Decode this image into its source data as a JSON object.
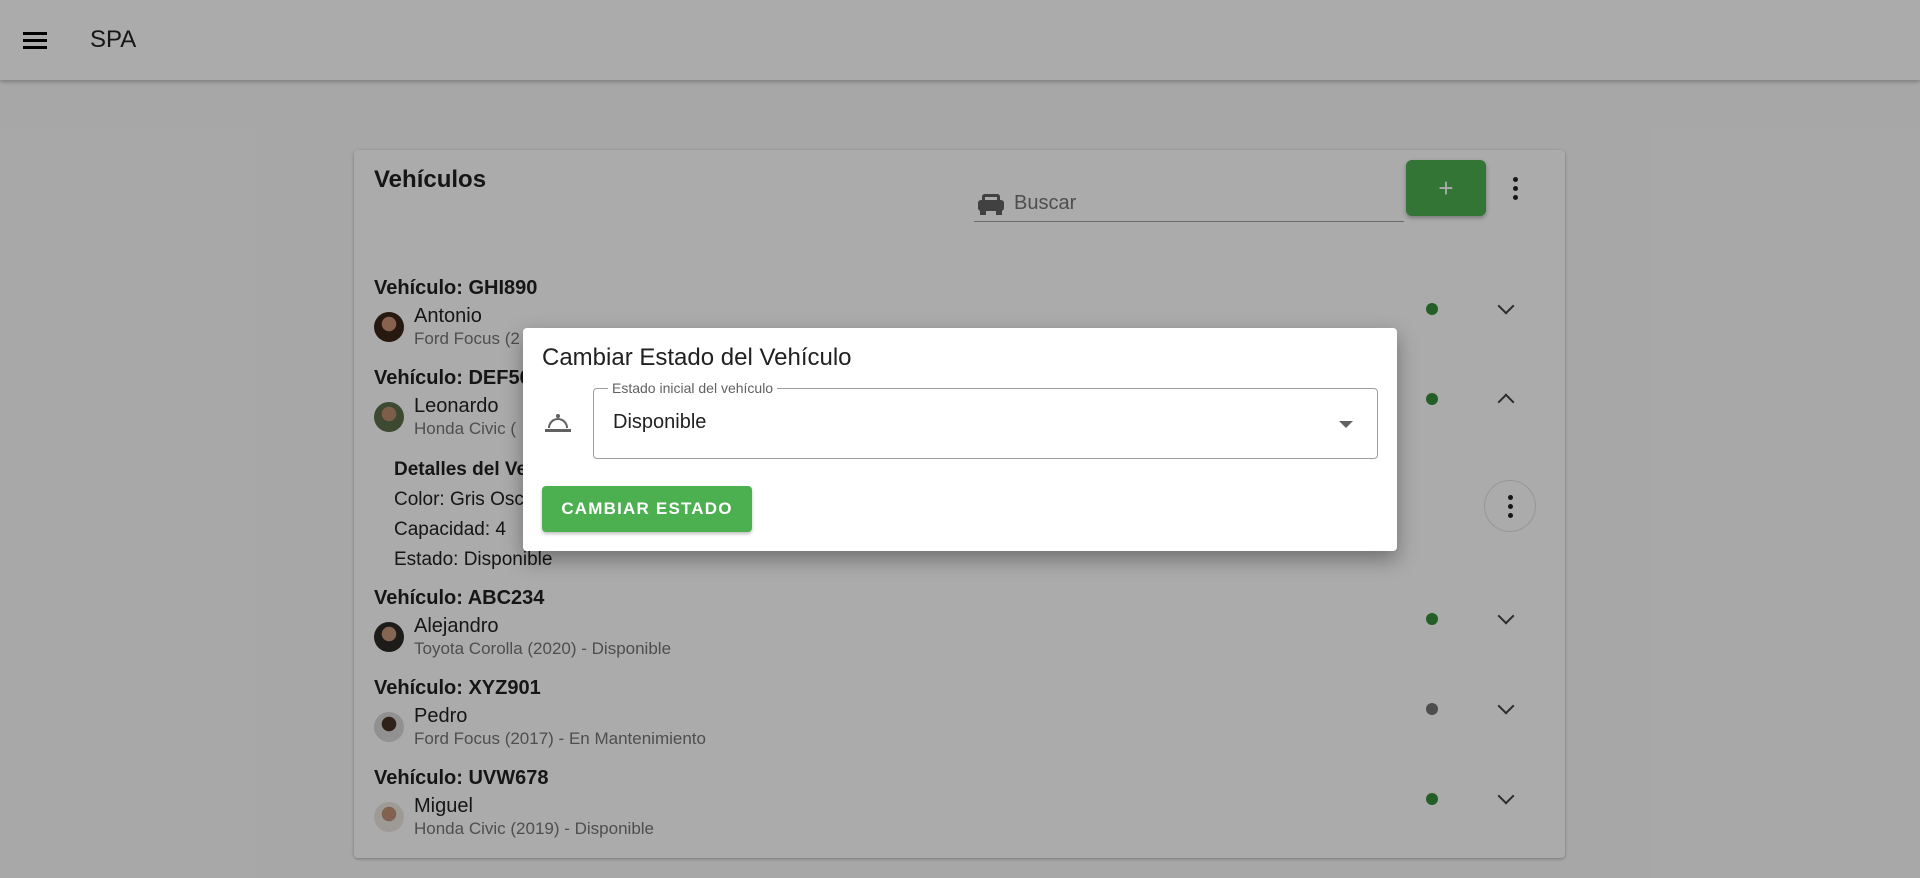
{
  "app": {
    "title": "SPA"
  },
  "card": {
    "title": "Vehículos",
    "search_placeholder": "Buscar",
    "add_label": "+"
  },
  "vehicles": [
    {
      "plate": "Vehículo: GHI890",
      "driver": "Antonio",
      "description": "Ford Focus (2",
      "status_color": "#388e3c",
      "expanded": false
    },
    {
      "plate": "Vehículo: DEF56",
      "driver": "Leonardo",
      "description": "Honda Civic (",
      "status_color": "#388e3c",
      "expanded": true
    },
    {
      "plate": "Vehículo: ABC234",
      "driver": "Alejandro",
      "description": "Toyota Corolla (2020) - Disponible",
      "status_color": "#388e3c",
      "expanded": false
    },
    {
      "plate": "Vehículo: XYZ901",
      "driver": "Pedro",
      "description": "Ford Focus (2017) - En Mantenimiento",
      "status_color": "#757575",
      "expanded": false
    },
    {
      "plate": "Vehículo: UVW678",
      "driver": "Miguel",
      "description": "Honda Civic (2019) - Disponible",
      "status_color": "#388e3c",
      "expanded": false
    }
  ],
  "details": {
    "title": "Detalles del Ve",
    "color": "Color: Gris Osc",
    "capacity": "Capacidad: 4",
    "status": "Estado: Disponible"
  },
  "dialog": {
    "title": "Cambiar Estado del Vehículo",
    "field_label": "Estado inicial del vehículo",
    "field_value": "Disponible",
    "button_label": "CAMBIAR ESTADO"
  }
}
